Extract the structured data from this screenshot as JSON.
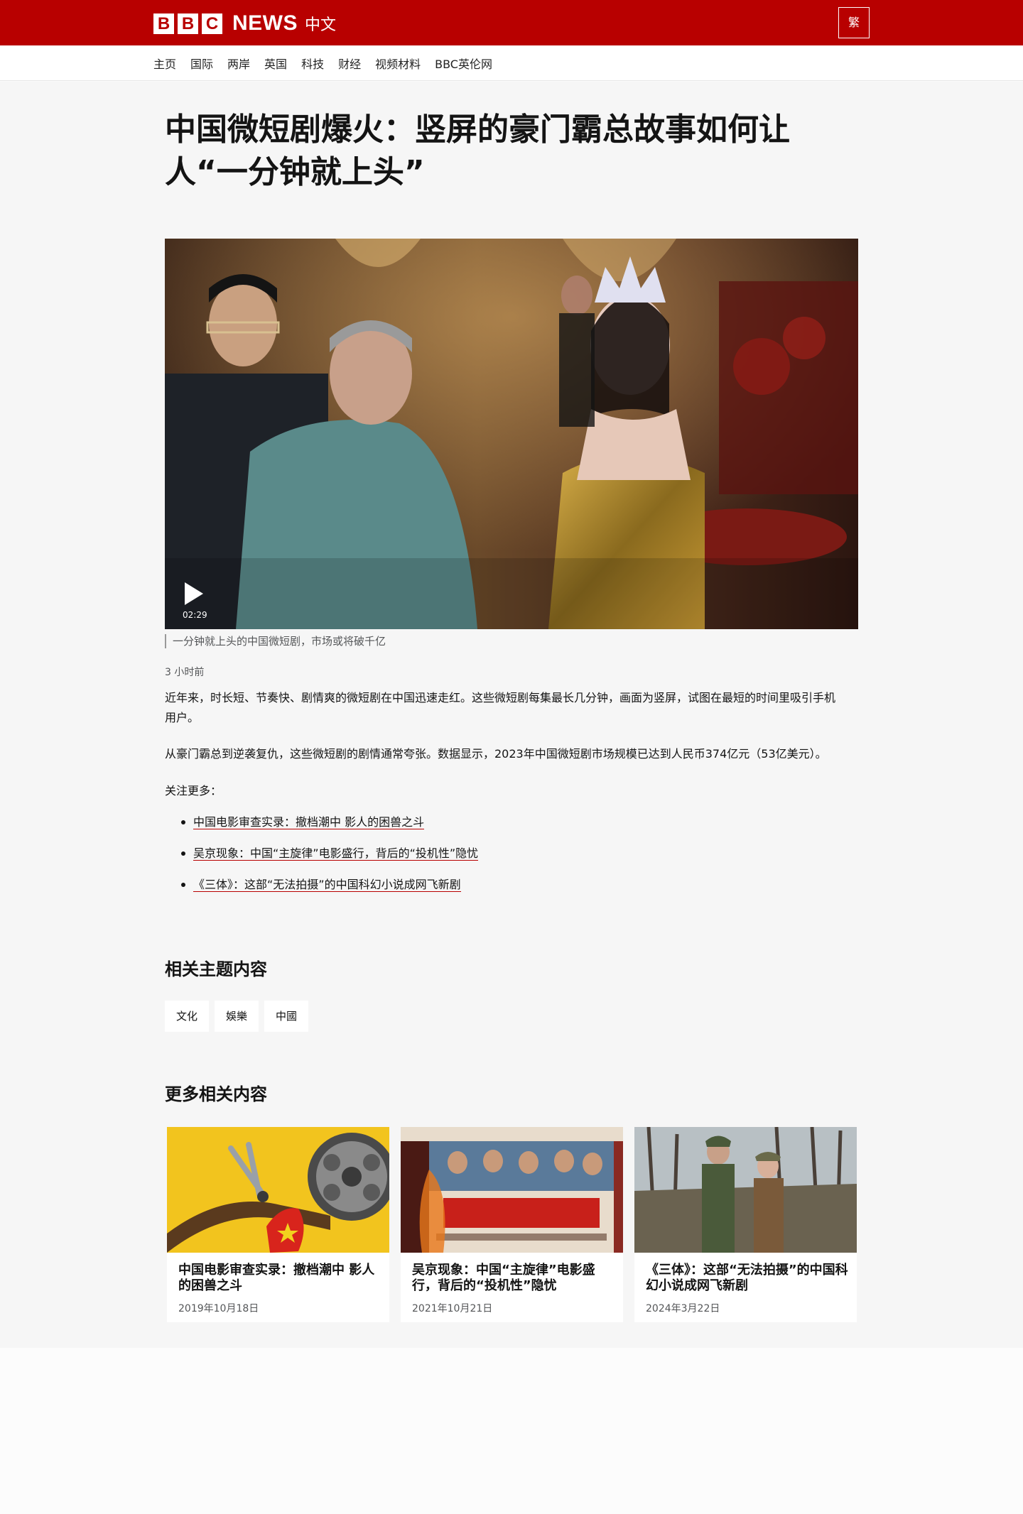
{
  "header": {
    "logo_letters": [
      "B",
      "B",
      "C"
    ],
    "logo_news": "NEWS",
    "logo_lang": "中文",
    "lang_toggle": "繁"
  },
  "nav": {
    "items": [
      {
        "label": "主页"
      },
      {
        "label": "国际"
      },
      {
        "label": "两岸"
      },
      {
        "label": "英国"
      },
      {
        "label": "科技"
      },
      {
        "label": "财经"
      },
      {
        "label": "视频材料"
      },
      {
        "label": "BBC英伦网"
      }
    ]
  },
  "article": {
    "headline": "中国微短剧爆火：竖屏的豪门霸总故事如何让人“一分钟就上头”",
    "video": {
      "duration": "02:29",
      "caption": "一分钟就上头的中国微短剧，市场或将破千亿"
    },
    "timestamp": "3 小时前",
    "paragraphs": [
      "近年来，时长短、节奏快、剧情爽的微短剧在中国迅速走红。这些微短剧每集最长几分钟，画面为竖屏，试图在最短的时间里吸引手机用户。",
      "从豪门霸总到逆袭复仇，这些微短剧的剧情通常夸张。数据显示，2023年中国微短剧市场规模已达到人民币374亿元（53亿美元）。",
      "关注更多："
    ],
    "related_links": [
      {
        "label": "中国电影审查实录：撤档潮中 影人的困兽之斗"
      },
      {
        "label": "吴京现象：中国“主旋律”电影盛行，背后的“投机性”隐忧"
      },
      {
        "label": "《三体》：这部“无法拍摄”的中国科幻小说成网飞新剧"
      }
    ]
  },
  "topics": {
    "title": "相关主题内容",
    "tags": [
      {
        "label": "文化"
      },
      {
        "label": "娛樂"
      },
      {
        "label": "中國"
      }
    ]
  },
  "more": {
    "title": "更多相关内容",
    "cards": [
      {
        "title": "中国电影审查实录：撤档潮中 影人的困兽之斗",
        "date": "2019年10月18日"
      },
      {
        "title": "吴京现象：中国“主旋律”电影盛行，背后的“投机性”隐忧",
        "date": "2021年10月21日"
      },
      {
        "title": "《三体》：这部“无法拍摄”的中国科幻小说成网飞新剧",
        "date": "2024年3月22日"
      }
    ]
  },
  "colors": {
    "brand_red": "#b80000",
    "page_bg": "#f6f6f6",
    "link_underline": "#b80000"
  },
  "icons": {
    "play": "play-icon",
    "bullet": "bullet-icon"
  }
}
